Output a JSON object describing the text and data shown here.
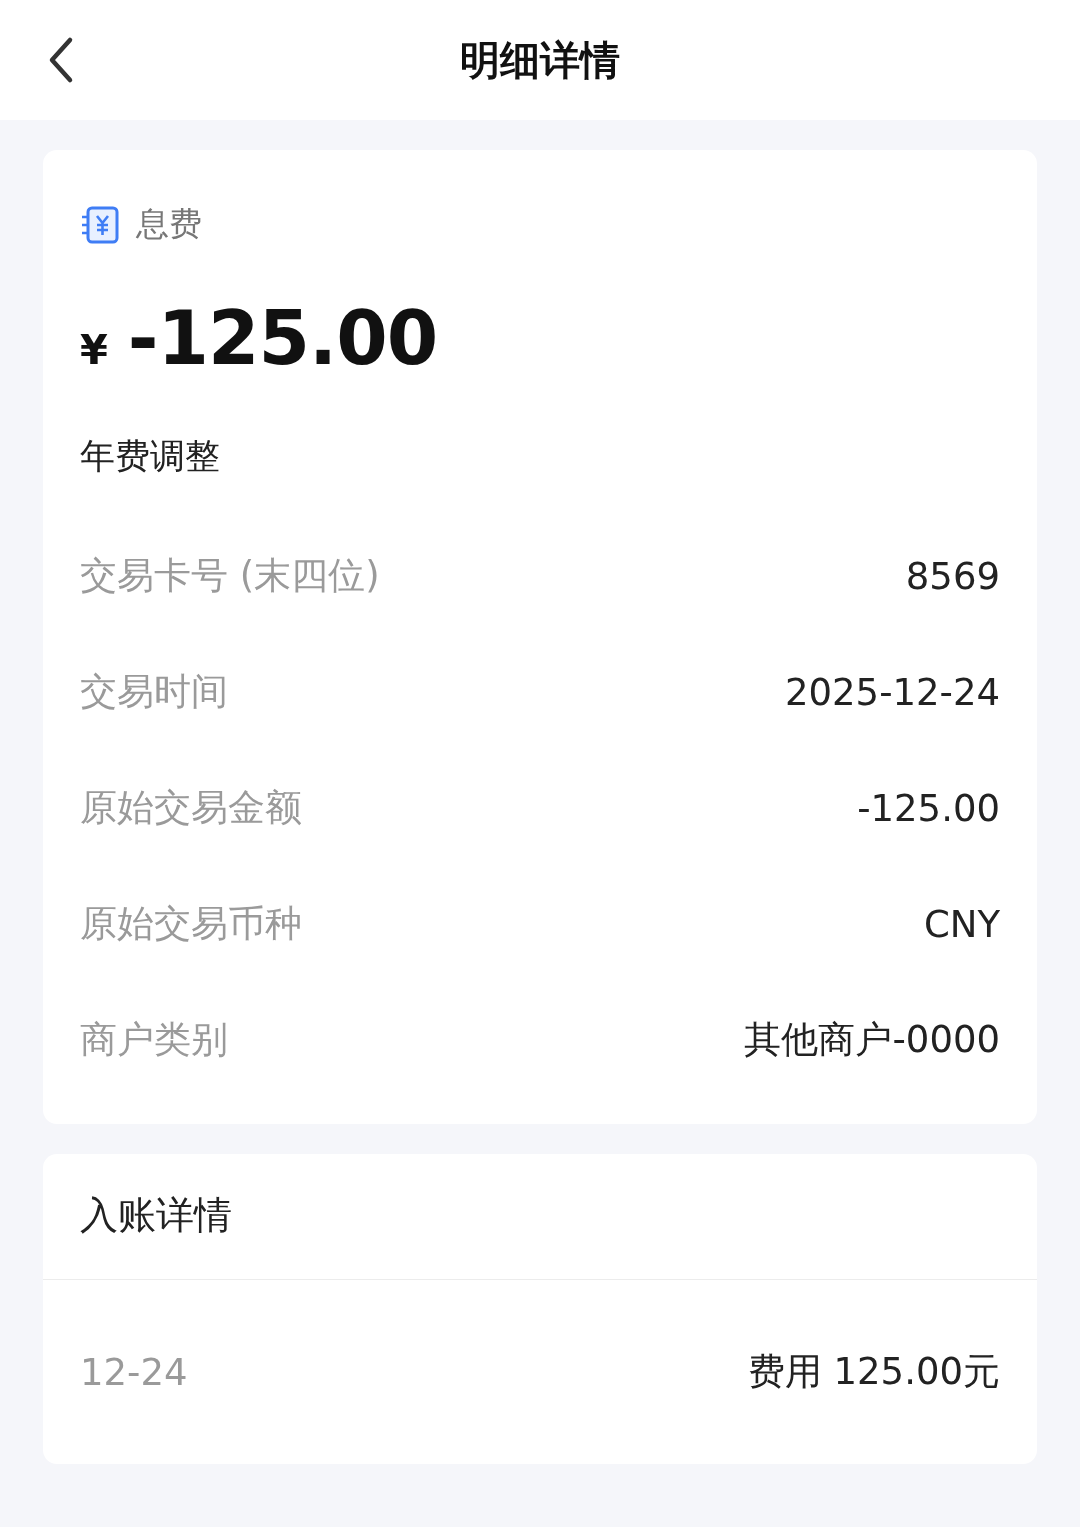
{
  "header": {
    "title": "明细详情"
  },
  "detail_card": {
    "category": "息费",
    "currency": "¥",
    "amount": "-125.00",
    "description": "年费调整",
    "rows": [
      {
        "label": "交易卡号 (末四位)",
        "value": "8569"
      },
      {
        "label": "交易时间",
        "value": "2025-12-24"
      },
      {
        "label": "原始交易金额",
        "value": "-125.00"
      },
      {
        "label": "原始交易币种",
        "value": "CNY"
      },
      {
        "label": "商户类别",
        "value": "其他商户-0000"
      }
    ]
  },
  "posting_card": {
    "title": "入账详情",
    "rows": [
      {
        "date": "12-24",
        "value": "费用 125.00元"
      }
    ]
  }
}
